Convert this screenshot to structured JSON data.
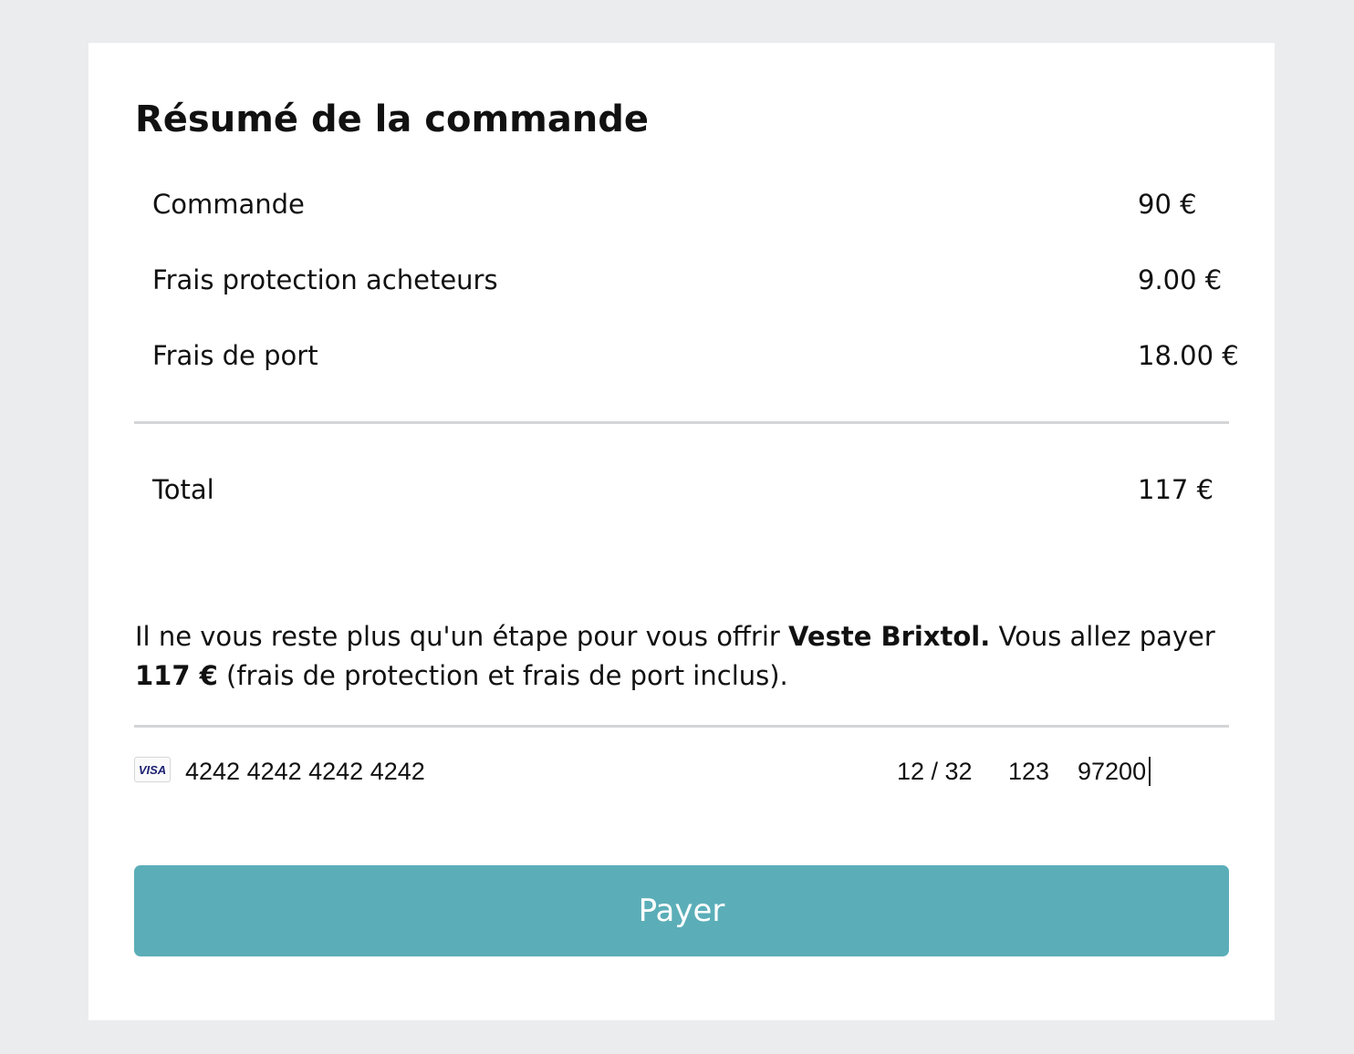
{
  "summary": {
    "title": "Résumé de la commande",
    "rows": [
      {
        "label": "Commande",
        "value": "90 €"
      },
      {
        "label": "Frais protection acheteurs",
        "value": "9.00 €"
      },
      {
        "label": "Frais de port",
        "value": "18.00 €"
      }
    ],
    "total": {
      "label": "Total",
      "value": "117 €"
    }
  },
  "message": {
    "prefix": "Il ne vous reste plus qu'un étape pour vous offrir ",
    "product": "Veste Brixtol.",
    "middle": " Vous allez payer ",
    "amount": "117 €",
    "suffix": " (frais de protection et frais de port inclus)."
  },
  "payment": {
    "card_brand": "VISA",
    "card_icon": "visa-card-icon",
    "card_number": "4242 4242 4242 4242",
    "expiry": "12 / 32",
    "cvc": "123",
    "postal_code": "97200"
  },
  "pay_button": {
    "label": "Payer"
  },
  "colors": {
    "background": "#ebecee",
    "card": "#ffffff",
    "divider": "#d4d5d7",
    "button": "#5baeb8",
    "visa_blue": "#1a1f71"
  }
}
